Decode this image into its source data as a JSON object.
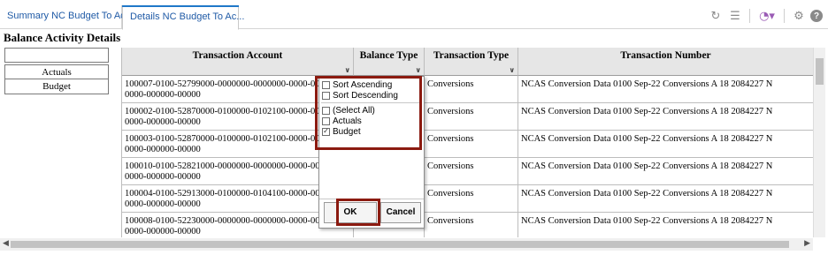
{
  "tabs": [
    {
      "label": "Summary NC Budget To Ac..."
    },
    {
      "label": "Details NC Budget To Ac..."
    }
  ],
  "toolbar": {
    "icons": [
      "refresh-icon",
      "list-icon",
      "query-dropdown-icon",
      "gear-icon",
      "help-icon"
    ],
    "help_label": "?"
  },
  "page_title": "Balance Activity Details",
  "left_table": {
    "rows": [
      "Actuals",
      "Budget"
    ]
  },
  "grid": {
    "columns": [
      {
        "label": "Transaction Account"
      },
      {
        "label": "Balance Type"
      },
      {
        "label": "Transaction Type"
      },
      {
        "label": "Transaction Number"
      }
    ],
    "rows": [
      {
        "account": "100007-0100-52799000-0000000-0000000-0000-000000-0000-000000-00000",
        "balance_type": "",
        "transaction_type": "Conversions",
        "number": "NCAS Conversion Data 0100 Sep-22 Conversions A 18 2084227 N"
      },
      {
        "account": "100002-0100-52870000-0100000-0102100-0000-000000-0000-000000-00000",
        "balance_type": "",
        "transaction_type": "Conversions",
        "number": "NCAS Conversion Data 0100 Sep-22 Conversions A 18 2084227 N"
      },
      {
        "account": "100003-0100-52870000-0100000-0102100-0000-000000-0000-000000-00000",
        "balance_type": "",
        "transaction_type": "Conversions",
        "number": "NCAS Conversion Data 0100 Sep-22 Conversions A 18 2084227 N"
      },
      {
        "account": "100010-0100-52821000-0000000-0000000-0000-000000-0000-000000-00000",
        "balance_type": "",
        "transaction_type": "Conversions",
        "number": "NCAS Conversion Data 0100 Sep-22 Conversions A 18 2084227 N"
      },
      {
        "account": "100004-0100-52913000-0100000-0104100-0000-000000-0000-000000-00000",
        "balance_type": "",
        "transaction_type": "Conversions",
        "number": "NCAS Conversion Data 0100 Sep-22 Conversions A 18 2084227 N"
      },
      {
        "account": "100008-0100-52230000-0000000-0000000-0000-000000-0000-000000-00000",
        "balance_type": "",
        "transaction_type": "Conversions",
        "number": "NCAS Conversion Data 0100 Sep-22 Conversions A 18 2084227 N"
      }
    ]
  },
  "filter_popup": {
    "sort_ascending": "Sort Ascending",
    "sort_descending": "Sort Descending",
    "select_all": "(Select All)",
    "options": [
      {
        "label": "Actuals",
        "checked": false
      },
      {
        "label": "Budget",
        "checked": true
      }
    ],
    "ok_label": "OK",
    "cancel_label": "Cancel"
  },
  "colors": {
    "tab_text": "#1f5aa6",
    "tab_accent": "#1f78c8",
    "header_bg": "#e6e6e6",
    "callout": "#8b1a10"
  }
}
